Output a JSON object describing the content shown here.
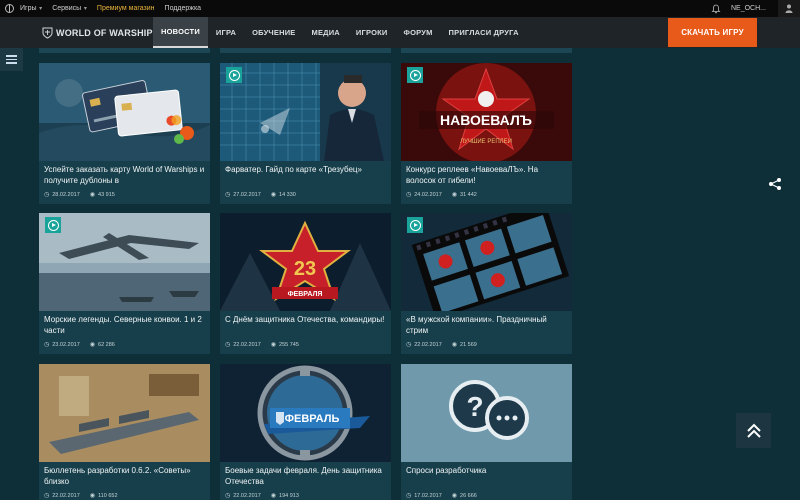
{
  "topbar": {
    "items": [
      {
        "label": "Игры",
        "has_chevron": true
      },
      {
        "label": "Сервисы",
        "has_chevron": true
      },
      {
        "label": "Премиум магазин",
        "accent": "#e8b23a"
      },
      {
        "label": "Поддержка"
      }
    ],
    "user_name": "NE_OCH..."
  },
  "nav": {
    "logo_text": "WORLD OF WARSHIPS",
    "items": [
      "НОВОСТИ",
      "ИГРА",
      "ОБУЧЕНИЕ",
      "МЕДИА",
      "ИГРОКИ",
      "ФОРУМ",
      "ПРИГЛАСИ ДРУГА"
    ],
    "active_index": 0,
    "download_label": "СКАЧАТЬ ИГРУ",
    "download_color": "#e85a1a"
  },
  "cards": [
    {
      "title": "Успейте заказать карту World of Warships и получите дублоны в",
      "date": "28.02.2017",
      "views": "43 915",
      "video": false,
      "theme": "card"
    },
    {
      "title": "Фарватер. Гайд по карте «Трезубец»",
      "date": "27.02.2017",
      "views": "14 330",
      "video": true,
      "theme": "guide"
    },
    {
      "title": "Конкурс реплеев «НавоеваЛЪ». На волосок от гибели!",
      "date": "24.02.2017",
      "views": "31 442",
      "video": true,
      "theme": "contest",
      "thumb_text": "НАВОЕВАЛЪ",
      "thumb_sub": "ЛУЧШИЕ РЕПЛЕИ"
    },
    {
      "title": "Морские легенды. Северные конвои. 1 и 2 части",
      "date": "23.02.2017",
      "views": "62 286",
      "video": true,
      "theme": "legends"
    },
    {
      "title": "С Днём защитника Отечества, командиры!",
      "date": "22.02.2017",
      "views": "255 745",
      "video": false,
      "theme": "holiday",
      "thumb_text": "23",
      "thumb_sub": "ФЕВРАЛЯ"
    },
    {
      "title": "«В мужской компании». Праздничный стрим",
      "date": "22.02.2017",
      "views": "21 569",
      "video": true,
      "theme": "stream"
    },
    {
      "title": "Бюллетень разработки 0.6.2. «Советы» близко",
      "date": "22.02.2017",
      "views": "110 652",
      "video": false,
      "theme": "bulletin"
    },
    {
      "title": "Боевые задачи февраля. День защитника Отечества",
      "date": "22.02.2017",
      "views": "194 913",
      "video": false,
      "theme": "tasks",
      "thumb_text": "ФЕВРАЛЬ"
    },
    {
      "title": "Спроси разработчика",
      "date": "17.02.2017",
      "views": "26 666",
      "video": false,
      "theme": "ask"
    }
  ]
}
